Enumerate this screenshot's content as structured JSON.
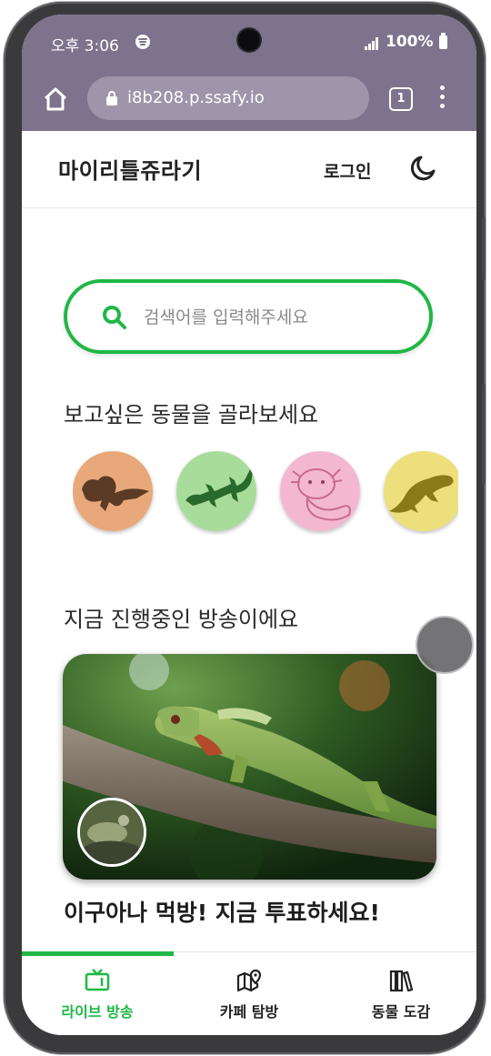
{
  "status_bar": {
    "time": "오후 3:06",
    "battery": "100%"
  },
  "browser": {
    "url": "i8b208.p.ssafy.io",
    "tab_count": "1"
  },
  "header": {
    "title": "마이리틀쥬라기",
    "login_label": "로그인"
  },
  "search": {
    "placeholder": "검색어를 입력해주세요"
  },
  "animals_section": {
    "title": "보고싶은 동물을 골라보세요",
    "circle_colors": [
      "#e8a87a",
      "#a8dc9a",
      "#f3b8cf",
      "#ecdf7c"
    ]
  },
  "live_section": {
    "title": "지금 진행중인 방송이에요"
  },
  "broadcast": {
    "title": "이구아나 먹방! 지금 투표하세요!"
  },
  "bottom_nav": {
    "items": [
      {
        "label": "라이브 방송",
        "icon": "tv-icon",
        "active": true
      },
      {
        "label": "카페 탐방",
        "icon": "map-pin-icon",
        "active": false
      },
      {
        "label": "동물 도감",
        "icon": "books-icon",
        "active": false
      }
    ]
  },
  "colors": {
    "accent": "#1fb745",
    "browser_bar": "#7d738c"
  }
}
